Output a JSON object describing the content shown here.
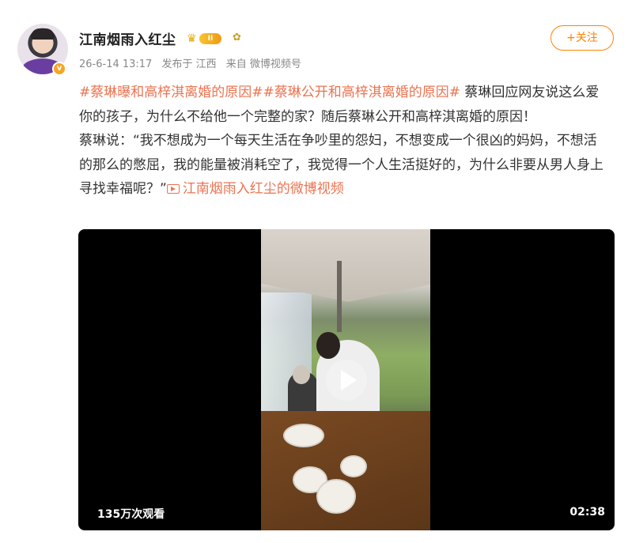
{
  "author": {
    "name": "江南烟雨入红尘",
    "level_badge": "II",
    "verified_badge": "v"
  },
  "meta": {
    "time": "26-6-14 13:17",
    "location": "发布于 江西",
    "source": "来自 微博视频号"
  },
  "follow_label": "+关注",
  "post": {
    "tag1": "#蔡琳曝和高梓淇离婚的原因#",
    "tag2": "#蔡琳公开和高梓淇离婚的原因#",
    "text1": " 蔡琳回应网友说这么爱你的孩子，为什么不给他一个完整的家？随后蔡琳公开和高梓淇离婚的原因！",
    "text2": "蔡琳说：“我不想成为一个每天生活在争吵里的怨妇，不想变成一个很凶的妈妈，不想活的那么的憋屈，我的能量被消耗空了，我觉得一个人生活挺好的，为什么非要从男人身上寻找幸福呢？”",
    "video_link": "江南烟雨入红尘的微博视频"
  },
  "video": {
    "views": "135万次观看",
    "duration": "02:38"
  },
  "colors": {
    "accent": "#ff8200",
    "link": "#eb7350"
  }
}
